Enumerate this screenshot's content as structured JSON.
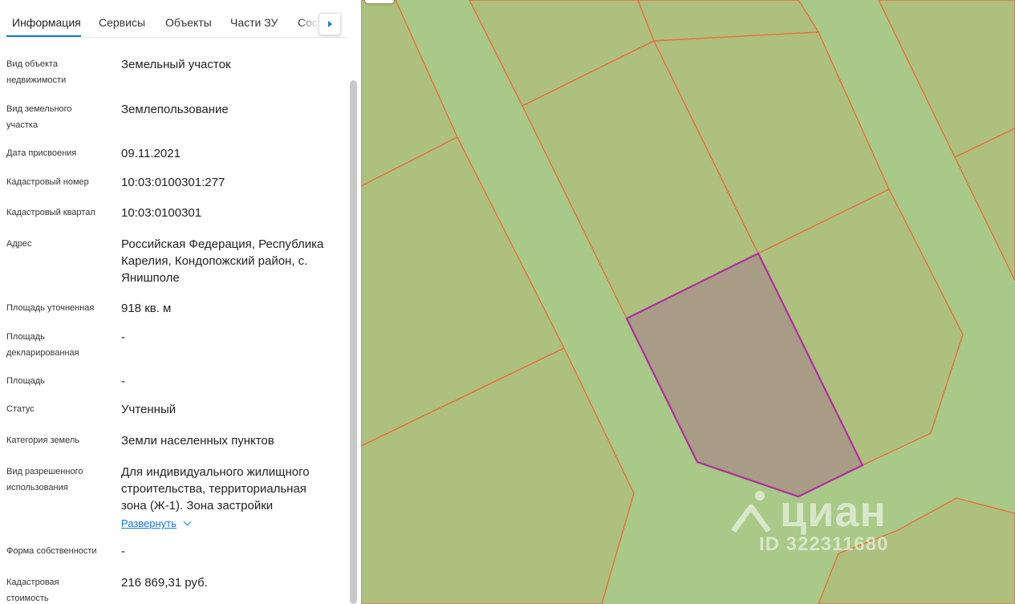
{
  "tabs": [
    {
      "label": "Информация",
      "active": true
    },
    {
      "label": "Сервисы",
      "active": false
    },
    {
      "label": "Объекты",
      "active": false
    },
    {
      "label": "Части ЗУ",
      "active": false
    },
    {
      "label": "Состав",
      "active": false
    }
  ],
  "properties": [
    {
      "label_lines": [
        "Вид объекта",
        "недвижимости"
      ],
      "value_lines": [
        "Земельный участок"
      ]
    },
    {
      "label_lines": [
        "Вид земельного",
        "участка"
      ],
      "value_lines": [
        "Землепользование"
      ]
    },
    {
      "label_lines": [
        "Дата присвоения"
      ],
      "value_lines": [
        "09.11.2021"
      ]
    },
    {
      "label_lines": [
        "Кадастровый номер"
      ],
      "value_lines": [
        "10:03:0100301:277"
      ]
    },
    {
      "label_lines": [
        "Кадастровый квартал"
      ],
      "value_lines": [
        "10:03:0100301"
      ]
    },
    {
      "label_lines": [
        "Адрес"
      ],
      "value_lines": [
        "Российская Федерация, Республика",
        "Карелия, Кондопожский район, с.",
        "Янишполе"
      ]
    },
    {
      "label_lines": [
        "Площадь уточненная"
      ],
      "value_lines": [
        "918 кв. м"
      ]
    },
    {
      "label_lines": [
        "Площадь",
        "декларированная"
      ],
      "value_lines": [
        "-"
      ]
    },
    {
      "label_lines": [
        "Площадь"
      ],
      "value_lines": [
        "-"
      ]
    },
    {
      "label_lines": [
        "Статус"
      ],
      "value_lines": [
        "Учтенный"
      ]
    },
    {
      "label_lines": [
        "Категория земель"
      ],
      "value_lines": [
        "Земли населенных пунктов"
      ]
    },
    {
      "label_lines": [
        "Вид разрешенного",
        "использования"
      ],
      "value_lines": [
        "Для индивидуального жилищного",
        "строительства, территориальная",
        "зона (Ж-1). Зона застройки"
      ],
      "expand_label": "Развернуть"
    },
    {
      "label_lines": [
        "Форма собственности"
      ],
      "value_lines": [
        "-"
      ]
    },
    {
      "label_lines": [
        "Кадастровая",
        "стоимость"
      ],
      "value_lines": [
        "216 869,31 руб."
      ]
    }
  ],
  "watermark": {
    "brand": "циан",
    "id_text": "ID 322311680"
  },
  "colors": {
    "accent": "#1a73e8",
    "parcel_fill": "#adc07e",
    "road_fill": "#a8c987",
    "boundary_line": "#e8703a",
    "selected_fill": "#a89c86",
    "selected_outline": "#b22ca0"
  }
}
